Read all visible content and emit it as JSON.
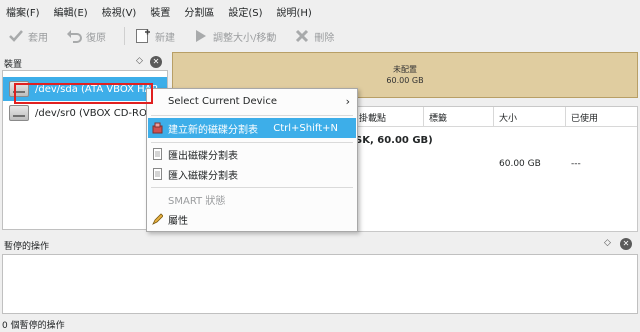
{
  "menubar": {
    "items": [
      "檔案(F)",
      "編輯(E)",
      "檢視(V)",
      "裝置",
      "分割區",
      "設定(S)",
      "說明(H)"
    ]
  },
  "toolbar": {
    "apply": "套用",
    "undo": "復原",
    "new": "新建",
    "resize": "調整大小/移動",
    "delete": "刪除"
  },
  "devices": {
    "header": "裝置",
    "items": [
      {
        "label": "/dev/sda (ATA VBOX HAR",
        "selected": true
      },
      {
        "label": "/dev/sr0 (VBOX CD-ROM",
        "selected": false
      }
    ]
  },
  "partition_graphic": {
    "label": "未配置",
    "size": "60.00 GB"
  },
  "partition_table": {
    "columns": [
      "掛載點",
      "標籤",
      "大小",
      "已使用"
    ],
    "disk_row": "SK, 60.00 GB)",
    "row_size": "60.00 GB",
    "row_used": "---"
  },
  "context_menu": {
    "select_device": "Select Current Device",
    "create_table": "建立新的磁碟分割表",
    "create_shortcut": "Ctrl+Shift+N",
    "export_table": "匯出磁碟分割表",
    "import_table": "匯入磁碟分割表",
    "smart": "SMART 狀態",
    "properties": "屬性"
  },
  "pending": {
    "header": "暫停的操作"
  },
  "statusbar": {
    "text": "0 個暫停的操作"
  }
}
